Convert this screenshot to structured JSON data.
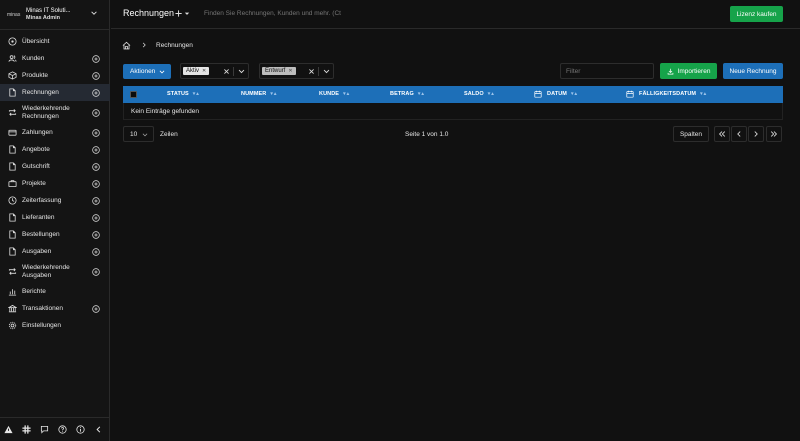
{
  "company": {
    "logo": "minas",
    "name": "Minas IT Soluti...",
    "user": "Minas Admin"
  },
  "nav": [
    {
      "label": "Übersicht",
      "icon": "home-icon",
      "plus": false
    },
    {
      "label": "Kunden",
      "icon": "users-icon",
      "plus": true
    },
    {
      "label": "Produkte",
      "icon": "box-icon",
      "plus": true
    },
    {
      "label": "Rechnungen",
      "icon": "file-icon",
      "plus": true,
      "active": true
    },
    {
      "label": "Wiederkehrende Rechnungen",
      "icon": "repeat-icon",
      "plus": true
    },
    {
      "label": "Zahlungen",
      "icon": "credit-card-icon",
      "plus": true
    },
    {
      "label": "Angebote",
      "icon": "file-icon",
      "plus": true
    },
    {
      "label": "Gutschrift",
      "icon": "file-icon",
      "plus": true
    },
    {
      "label": "Projekte",
      "icon": "briefcase-icon",
      "plus": true
    },
    {
      "label": "Zeiterfassung",
      "icon": "clock-icon",
      "plus": true
    },
    {
      "label": "Lieferanten",
      "icon": "file-icon",
      "plus": true
    },
    {
      "label": "Bestellungen",
      "icon": "file-icon",
      "plus": true
    },
    {
      "label": "Ausgaben",
      "icon": "file-icon",
      "plus": true
    },
    {
      "label": "Wiederkehrende Ausgaben",
      "icon": "repeat-icon",
      "plus": true
    },
    {
      "label": "Berichte",
      "icon": "chart-icon",
      "plus": false
    },
    {
      "label": "Transaktionen",
      "icon": "bank-icon",
      "plus": true
    },
    {
      "label": "Einstellungen",
      "icon": "gear-icon",
      "plus": false
    }
  ],
  "header": {
    "title": "Rechnungen",
    "search_placeholder": "Finden Sie Rechnungen, Kunden und mehr. (Ct",
    "license_label": "Lizenz kaufen"
  },
  "breadcrumb": {
    "current": "Rechnungen"
  },
  "toolbar": {
    "actions_label": "Aktionen",
    "status_filter_chip": "Aktiv",
    "status_filter_chip2": "Entwurf",
    "filter_placeholder": "Filter",
    "import_label": "Importieren",
    "new_label": "Neue Rechnung"
  },
  "table": {
    "columns": [
      "STATUS",
      "NUMMER",
      "KUNDE",
      "BETRAG",
      "SALDO",
      "DATUM",
      "FÄLLIGKEITSDATUM"
    ],
    "empty_text": "Kein Einträge gefunden"
  },
  "pagination": {
    "per_page": "10",
    "per_page_label": "Zeilen",
    "page_info": "Seite 1 von 1.0",
    "columns_label": "Spalten"
  },
  "colors": {
    "primary": "#1d6fb8",
    "success": "#16a34a",
    "background": "#111111"
  }
}
